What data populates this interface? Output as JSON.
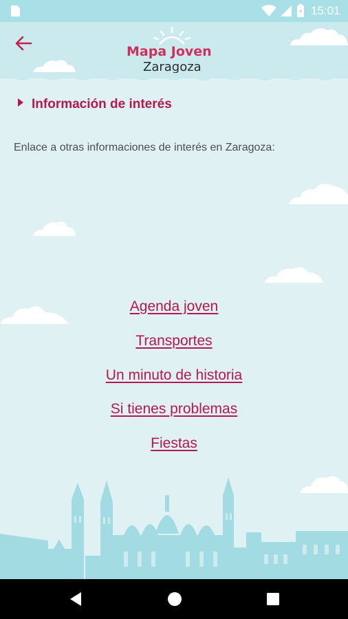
{
  "status_bar": {
    "time": "15:01",
    "icons": [
      "sim-card-icon",
      "wifi-icon",
      "cellular-icon",
      "battery-icon"
    ]
  },
  "header": {
    "logo_title": "Mapa Joven",
    "logo_subtitle": "Zaragoza",
    "back_icon": "arrow-left-icon"
  },
  "section": {
    "title": "Información de interés"
  },
  "intro_text": "Enlace a otras informaciones de interés en Zaragoza:",
  "links": [
    {
      "label": "Agenda joven"
    },
    {
      "label": "Transportes"
    },
    {
      "label": "Un minuto de historia"
    },
    {
      "label": "Si tienes problemas"
    },
    {
      "label": "Fiestas"
    }
  ],
  "nav_bar": {
    "icons": [
      "nav-back-icon",
      "nav-home-icon",
      "nav-recents-icon"
    ]
  },
  "colors": {
    "accent": "#b5184a",
    "sky": "#dff1f3",
    "header": "#cbeaee",
    "skyline": "#8fd3dc"
  }
}
